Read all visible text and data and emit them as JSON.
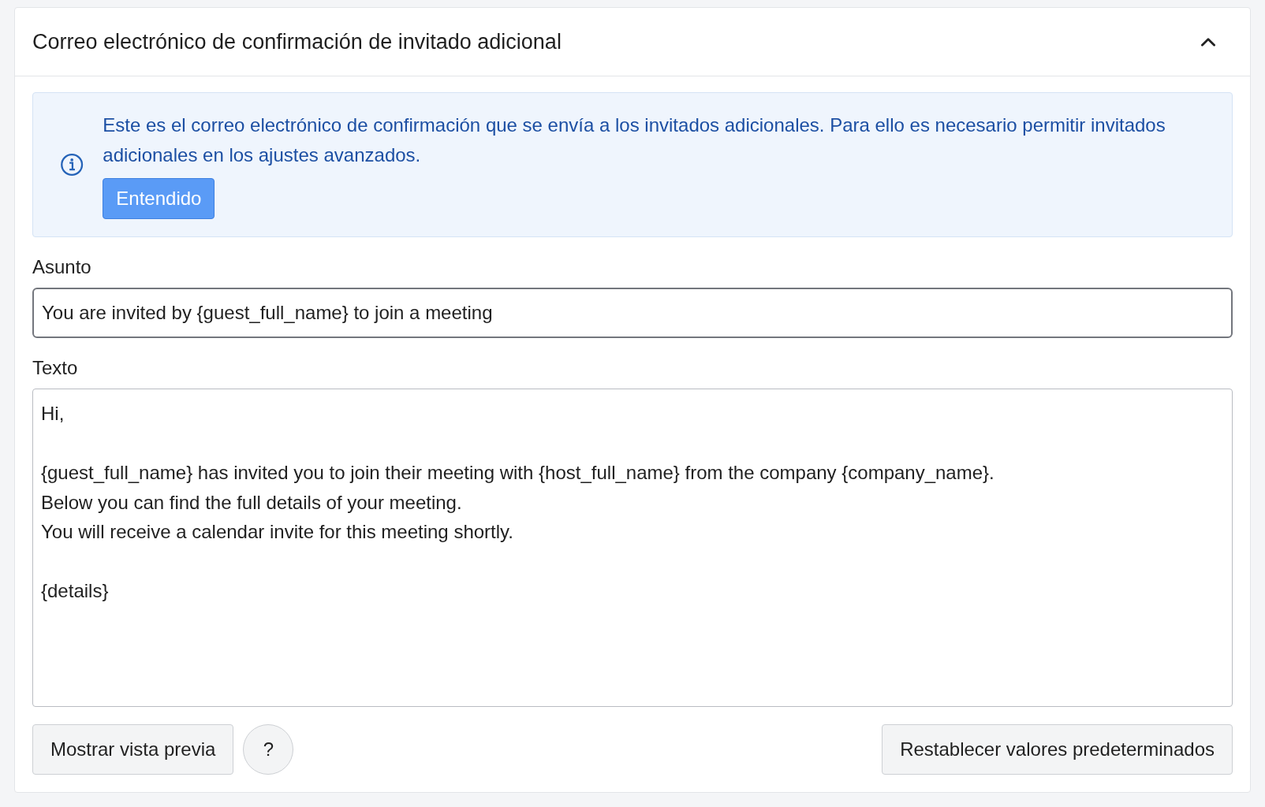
{
  "panel": {
    "title": "Correo electrónico de confirmación de invitado adicional",
    "expanded": true
  },
  "notice": {
    "text": "Este es el correo electrónico de confirmación que se envía a los invitados adicionales. Para ello es necesario permitir invitados adicionales en los ajustes avanzados.",
    "button": "Entendido"
  },
  "subject": {
    "label": "Asunto",
    "value": "You are invited by {guest_full_name} to join a meeting"
  },
  "body": {
    "label": "Texto",
    "value": "Hi,\n\n{guest_full_name} has invited you to join their meeting with {host_full_name} from the company {company_name}.\nBelow you can find the full details of your meeting.\nYou will receive a calendar invite for this meeting shortly.\n\n{details}"
  },
  "buttons": {
    "preview": "Mostrar vista previa",
    "help": "?",
    "reset": "Restablecer valores predeterminados"
  }
}
